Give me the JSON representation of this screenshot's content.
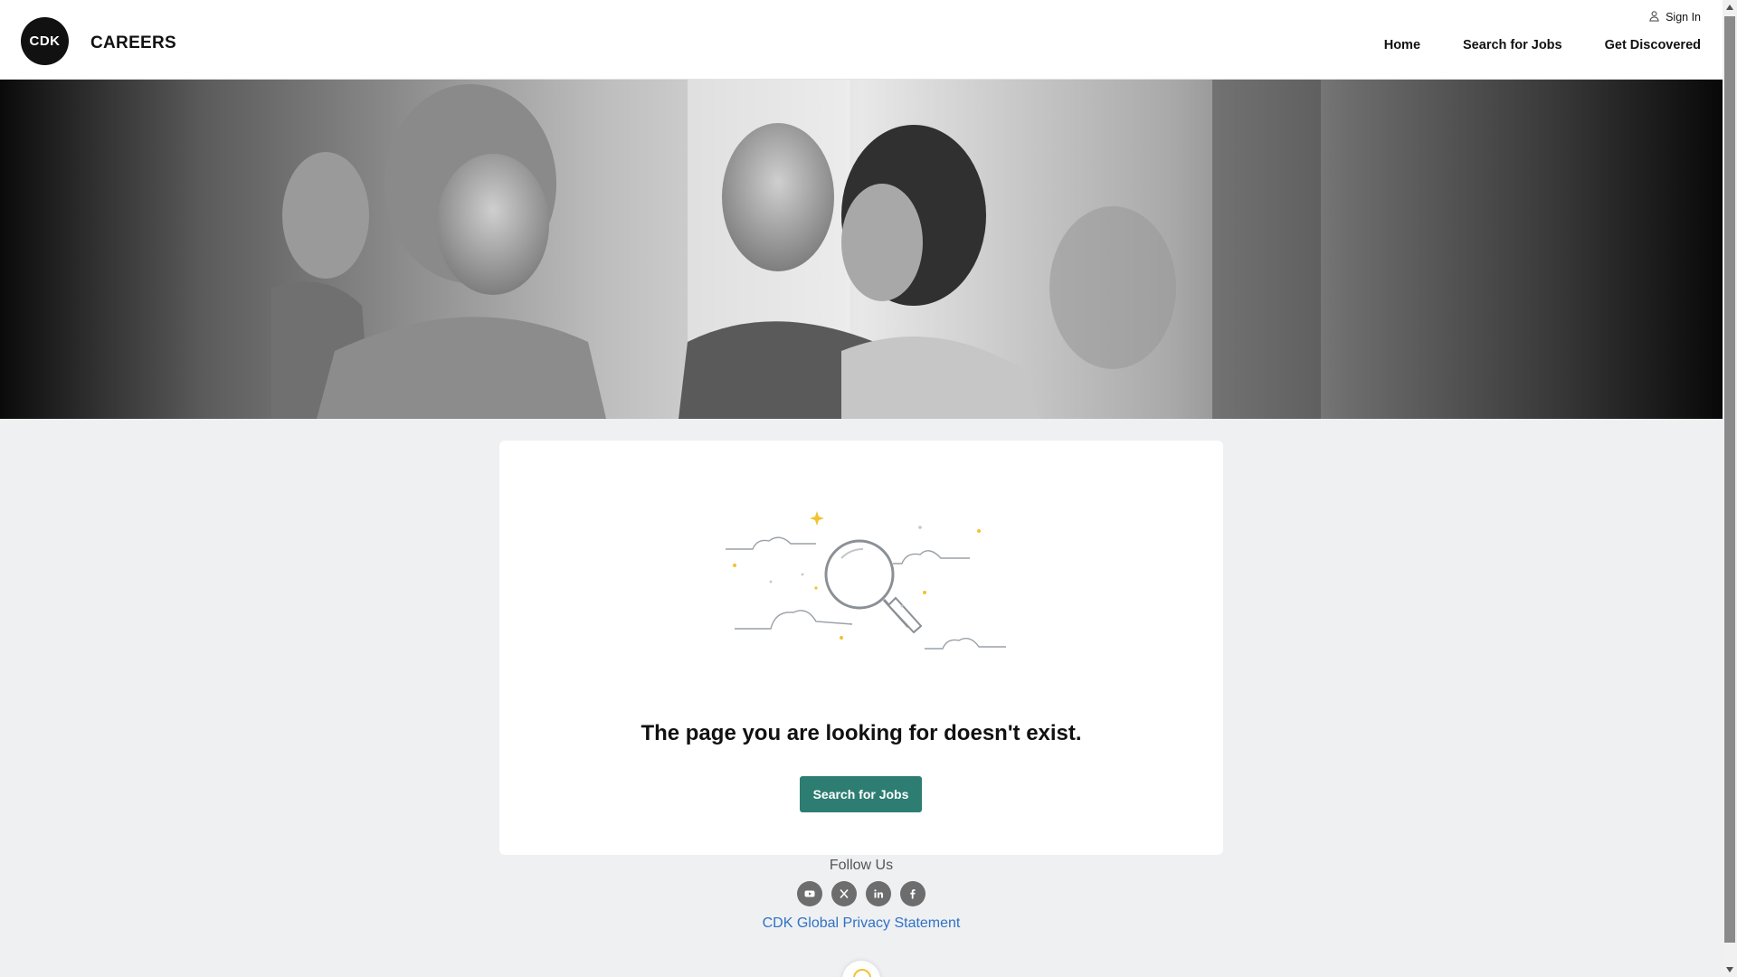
{
  "header": {
    "logo_text": "CDK",
    "title": "CAREERS",
    "sign_in": "Sign In",
    "nav": [
      {
        "label": "Home"
      },
      {
        "label": "Search for Jobs"
      },
      {
        "label": "Get Discovered"
      }
    ]
  },
  "hero": {
    "icon": "hero-photo"
  },
  "card": {
    "message": "The page you are looking for doesn't exist.",
    "button_label": "Search for Jobs",
    "illustration_icon": "magnifying-glass-illustration"
  },
  "footer": {
    "follow_label": "Follow Us",
    "socials": [
      {
        "icon": "youtube-icon"
      },
      {
        "icon": "x-icon"
      },
      {
        "icon": "linkedin-icon"
      },
      {
        "icon": "facebook-icon"
      }
    ],
    "privacy_link": "CDK Global Privacy Statement"
  },
  "colors": {
    "accent": "#2e7d72",
    "link": "#2f72c4",
    "background": "#eff0f2",
    "star": "#f1c232"
  }
}
